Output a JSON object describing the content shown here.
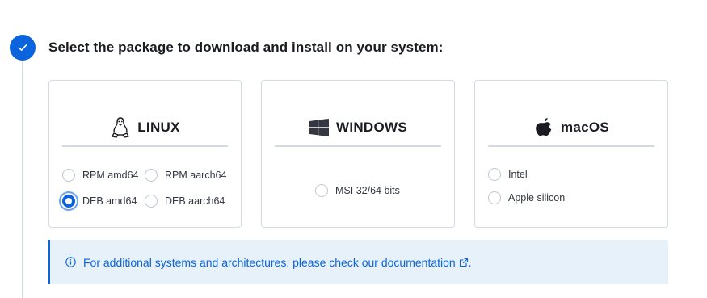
{
  "step": {
    "title": "Select the package to download and install on your system:"
  },
  "cards": {
    "linux": {
      "name": "LINUX",
      "icon": "linux-icon",
      "options": [
        {
          "label": "RPM amd64",
          "checked": false
        },
        {
          "label": "RPM aarch64",
          "checked": false
        },
        {
          "label": "DEB amd64",
          "checked": true
        },
        {
          "label": "DEB aarch64",
          "checked": false
        }
      ]
    },
    "windows": {
      "name": "WINDOWS",
      "icon": "windows-icon",
      "options": [
        {
          "label": "MSI 32/64 bits",
          "checked": false
        }
      ]
    },
    "macos": {
      "name": "macOS",
      "icon": "apple-icon",
      "options": [
        {
          "label": "Intel",
          "checked": false
        },
        {
          "label": "Apple silicon",
          "checked": false
        }
      ]
    }
  },
  "callout": {
    "prefix": "For additional systems and architectures, please check our ",
    "link": "documentation",
    "suffix": "."
  },
  "colors": {
    "accent": "#0b64dd",
    "callout_bg": "#e6f1fa",
    "border": "#d3dae6"
  }
}
